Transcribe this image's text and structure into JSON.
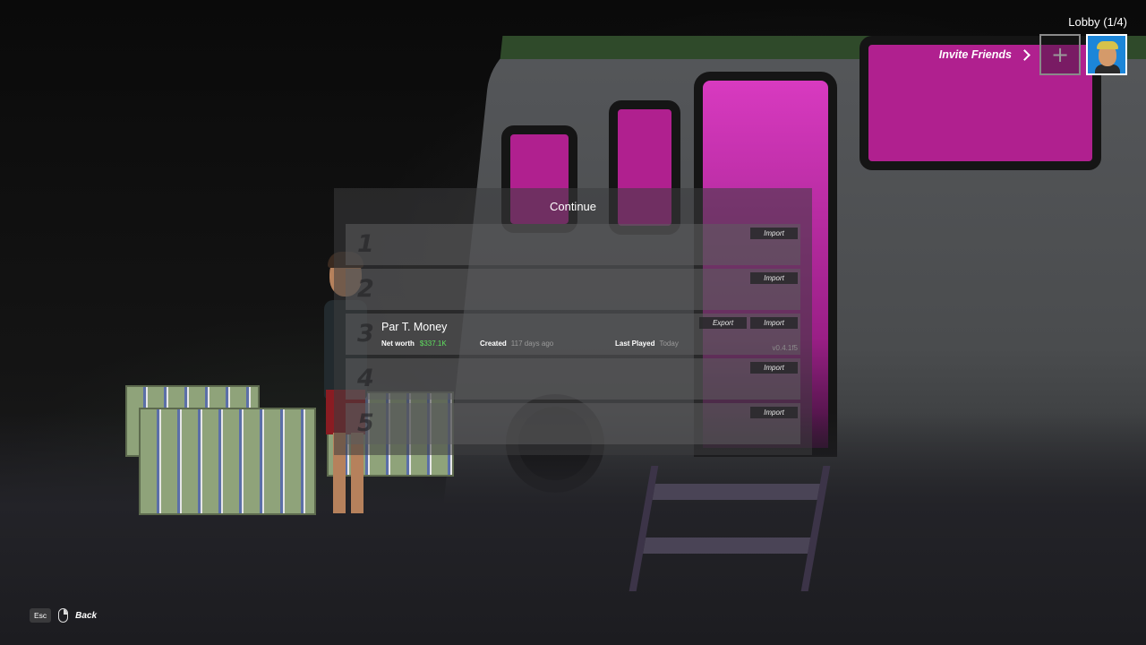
{
  "lobby": {
    "title": "Lobby (1/4)",
    "invite_label": "Invite Friends",
    "add_symbol": "+"
  },
  "panel": {
    "title": "Continue",
    "slots": [
      {
        "number": "1",
        "import_label": "Import"
      },
      {
        "number": "2",
        "import_label": "Import"
      },
      {
        "number": "3",
        "export_label": "Export",
        "import_label": "Import",
        "save_name": "Par T. Money",
        "net_worth_label": "Net worth",
        "net_worth_value": "$337.1K",
        "created_label": "Created",
        "created_value": "117 days ago",
        "last_played_label": "Last Played",
        "last_played_value": "Today",
        "version": "v0.4.1f5"
      },
      {
        "number": "4",
        "import_label": "Import"
      },
      {
        "number": "5",
        "import_label": "Import"
      }
    ]
  },
  "hint": {
    "key": "Esc",
    "action": "Back"
  },
  "colors": {
    "money_green": "#5fe05f",
    "avatar_bg": "#1c86d9",
    "panel_bg": "rgba(60,60,62,0.55)"
  },
  "icons": {
    "invite": "chevron-right-icon",
    "mouse": "mouse-icon"
  }
}
